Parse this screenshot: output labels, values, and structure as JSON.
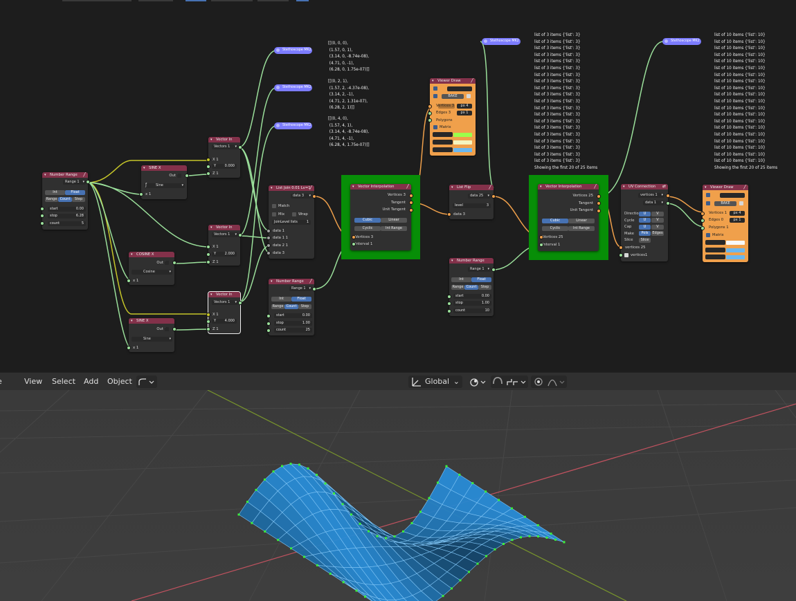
{
  "nodes": {
    "number_range_1": {
      "title": "Number Range",
      "out": "Range 1",
      "modes": [
        "Int",
        "Float"
      ],
      "steps": [
        "Range",
        "Count",
        "Step"
      ],
      "fields": [
        {
          "l": "start",
          "v": "0.00"
        },
        {
          "l": "stop",
          "v": "6.28"
        },
        {
          "l": "count",
          "v": "5"
        }
      ]
    },
    "sine_x_1": {
      "title": "SINE X",
      "out": "Out 1",
      "func": "Sine",
      "in": "x 1"
    },
    "vector_in_1": {
      "title": "Vector In",
      "out": "Vectors 1",
      "x": "X 1",
      "y_label": "Y",
      "y_val": "0.000",
      "z": "Z 1"
    },
    "cosine_x": {
      "title": "COSINE X",
      "out": "Out 1",
      "func": "Cosine",
      "in": "x 1"
    },
    "vector_in_2": {
      "title": "Vector In",
      "out": "Vectors 1",
      "x": "X 1",
      "y_label": "Y",
      "y_val": "2.000",
      "z": "Z 1"
    },
    "vector_in_3": {
      "title": "Vector In",
      "out": "Vectors 1",
      "x": "X 1",
      "y_label": "Y",
      "y_val": "4.000",
      "z": "Z 1"
    },
    "sine_x_2": {
      "title": "SINE X",
      "out": "Out 1",
      "func": "Sine",
      "in": "x 1"
    },
    "list_join": {
      "title": "List Join 0.01 Lv=1",
      "out": "data 3",
      "opts": [
        "Match",
        "Mix",
        "Wrap"
      ],
      "join_level_label": "JoinLevel lists",
      "join_level": "1",
      "ins": [
        "data 1",
        "data 1 1",
        "data 2 1",
        "data 3"
      ]
    },
    "number_range_2": {
      "title": "Number Range",
      "out": "Range 1",
      "modes": [
        "Int",
        "Float"
      ],
      "steps": [
        "Range",
        "Count",
        "Step"
      ],
      "fields": [
        {
          "l": "start",
          "v": "0.00"
        },
        {
          "l": "stop",
          "v": "1.00"
        },
        {
          "l": "count",
          "v": "25"
        }
      ]
    },
    "vec_interp_1": {
      "title": "Vector Interpolation",
      "outs": [
        "Vertices 3",
        "Tangent",
        "Unit Tangent"
      ],
      "modes": [
        "Cubic",
        "Linear"
      ],
      "mods": [
        "Cyclic",
        "Int Range"
      ],
      "ins": [
        "Vertices 3",
        "Interval 1"
      ]
    },
    "viewer_draw_1": {
      "title": "Viewer Draw",
      "bake": "BAKE",
      "rows": [
        "Vertices 3",
        "Edges 3",
        "Polygons",
        "Matrix"
      ],
      "px1": "px   4",
      "px2": "px   1"
    },
    "list_flip": {
      "title": "List Flip",
      "out": "data 25",
      "level_label": "level",
      "level": "3",
      "in": "data 3"
    },
    "number_range_3": {
      "title": "Number Range",
      "out": "Range 1",
      "modes": [
        "Int",
        "Float"
      ],
      "steps": [
        "Range",
        "Count",
        "Step"
      ],
      "fields": [
        {
          "l": "start",
          "v": "0.00"
        },
        {
          "l": "stop",
          "v": "1.00"
        },
        {
          "l": "count",
          "v": "10"
        }
      ]
    },
    "vec_interp_2": {
      "title": "Vector Interpolation",
      "outs": [
        "Vertices 25",
        "Tangent",
        "Unit Tangent"
      ],
      "modes": [
        "Cubic",
        "Linear"
      ],
      "mods": [
        "Cyclic",
        "Int Range"
      ],
      "ins": [
        "Vertices 25",
        "Interval 1"
      ]
    },
    "uv_connection": {
      "title": "UV Connection",
      "outs": [
        "vertices 1",
        "data 1"
      ],
      "rows": [
        {
          "l": "Directio",
          "a": "U",
          "b": "V"
        },
        {
          "l": "Cycle",
          "a": "U",
          "b": "V"
        },
        {
          "l": "Cap",
          "a": "U",
          "b": "V"
        },
        {
          "l": "Make",
          "a": "Pols",
          "b": "Edges"
        },
        {
          "l": "Slice",
          "a": "Slice",
          "b": ""
        }
      ],
      "ins": [
        "vertices 25",
        "vertices1"
      ]
    },
    "viewer_draw_2": {
      "title": "Viewer Draw",
      "bake": "BAKE",
      "rows": [
        "Vertices 1",
        "Edges 0",
        "Polygons 1",
        "Matrix"
      ],
      "px1": "px   4",
      "px2": "px   1"
    }
  },
  "stethoscopes": [
    "Stethoscope MK2",
    "Stethoscope MK2",
    "Stethoscope MK2",
    "Stethoscope MK2",
    "Stethoscope MK2"
  ],
  "outputs": {
    "o1": "[[(0, 0, 0),\n (1.57, 0, 1),\n (3.14, 0, -8.74e-08),\n (4.71, 0, -1),\n (6.28, 0, 1.75e-07)]]",
    "o2": "[[(0, 2, 1),\n (1.57, 2, -4.37e-08),\n (3.14, 2, -1),\n (4.71, 2, 1.31e-07),\n (6.28, 2, 1)]]",
    "o3": "[[(0, 4, 0),\n (1.57, 4, 1),\n (3.14, 4, -8.74e-08),\n (4.71, 4, -1),\n (6.28, 4, 1.75e-07)]]",
    "o4_line": "list of 3 items {'list': 3}",
    "o4_footer": "Showing the first 20 of 25 items",
    "o5_line": "list of 10 items {'list': 10}",
    "o5_footer": "Showing the first 20 of 25 items"
  },
  "viewport_header": {
    "menu": [
      "View",
      "Select",
      "Add",
      "Object"
    ],
    "transform": "Global"
  },
  "colors": {
    "node_bg": "#303030",
    "frame": "#078e07",
    "viewer": "#f0a04b",
    "mesh": "#3c8fd8",
    "stethoscope": "#7c7cff"
  }
}
